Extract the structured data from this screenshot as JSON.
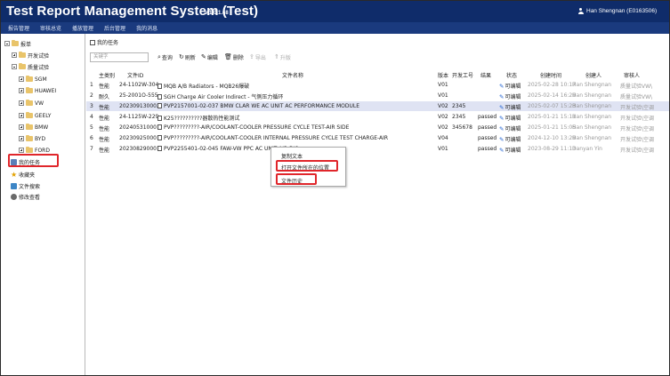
{
  "app": {
    "title": "Test Report Management System (Test)",
    "version": "v 1.0.1.68",
    "user": "Han Shengnan (E0163506)"
  },
  "menu": [
    "报告管理",
    "审核总览",
    "播放管理",
    "后台管理",
    "我的消息"
  ],
  "sidebar": {
    "items": [
      {
        "label": "报单",
        "level": 0,
        "expander": "minus",
        "icon": "folder-icon"
      },
      {
        "label": "开发试验",
        "level": 1,
        "expander": "plus",
        "icon": "folder-icon"
      },
      {
        "label": "质量试验",
        "level": 1,
        "expander": "minus",
        "icon": "folder-icon"
      },
      {
        "label": "SGM",
        "level": 2,
        "expander": "plus",
        "icon": "folder-icon"
      },
      {
        "label": "HUAWEI",
        "level": 2,
        "expander": "plus",
        "icon": "folder-icon"
      },
      {
        "label": "VW",
        "level": 2,
        "expander": "plus",
        "icon": "folder-icon"
      },
      {
        "label": "GEELY",
        "level": 2,
        "expander": "plus",
        "icon": "folder-icon"
      },
      {
        "label": "BMW",
        "level": 2,
        "expander": "plus",
        "icon": "folder-icon"
      },
      {
        "label": "BYD",
        "level": 2,
        "expander": "plus",
        "icon": "folder-icon"
      },
      {
        "label": "FORD",
        "level": 2,
        "expander": "plus",
        "icon": "folder-icon"
      },
      {
        "label": "我的任务",
        "level": 0,
        "expander": "none",
        "icon": "task-icon"
      },
      {
        "label": "收藏夹",
        "level": 0,
        "expander": "none",
        "icon": "star-icon"
      },
      {
        "label": "文件搜索",
        "level": 0,
        "expander": "none",
        "icon": "search-icon"
      },
      {
        "label": "修改查看",
        "level": 0,
        "expander": "none",
        "icon": "history-icon"
      }
    ]
  },
  "tab": {
    "label": "我的任务"
  },
  "toolbar": {
    "search_placeholder": "关键字",
    "buttons": [
      {
        "label": "查询",
        "icon": "search-icon",
        "disabled": false
      },
      {
        "label": "刷新",
        "icon": "refresh-icon",
        "disabled": false
      },
      {
        "label": "编辑",
        "icon": "edit-icon",
        "disabled": false
      },
      {
        "label": "删除",
        "icon": "delete-icon",
        "disabled": false
      },
      {
        "label": "导出",
        "icon": "export-icon",
        "disabled": true
      },
      {
        "label": "升版",
        "icon": "upgrade-icon",
        "disabled": true
      }
    ]
  },
  "table": {
    "columns": [
      "",
      "主类别",
      "文件ID",
      "文件名称",
      "版本",
      "开发工号",
      "结果",
      "状态",
      "创建时间",
      "创建人",
      "审核人"
    ],
    "rows": [
      {
        "no": "1",
        "cat": "性能",
        "id": "24-1102W-304",
        "name": "MQB A/B Radiators - MQB26爆破",
        "ver": "V01",
        "devno": "",
        "result": "",
        "status": "可编辑",
        "created": "2025-02-28 10:17",
        "creator": "Han Shengnan",
        "reviewer": "质量试验VW\\"
      },
      {
        "no": "2",
        "cat": "耐久",
        "id": "25-2001O-555",
        "name": "SGH Charge Air Cooler Indirect - 气侧压力循环",
        "ver": "V01",
        "devno": "",
        "result": "",
        "status": "可编辑",
        "created": "2025-02-14 16:29",
        "creator": "Han Shengnan",
        "reviewer": "质量试验VW\\"
      },
      {
        "no": "3",
        "cat": "性能",
        "id": "202309130002",
        "name": "PVP2157001-02-037 BMW CLAR WE AC UNIT AC PERFORMANCE MODULE",
        "ver": "V02",
        "devno": "2345",
        "result": "",
        "status": "可编辑",
        "created": "2025-02-07 15:23",
        "creator": "Han Shengnan",
        "reviewer": "开发试验\\空调"
      },
      {
        "no": "4",
        "cat": "性能",
        "id": "24-1125W-229",
        "name": "K25??????????器散热性能测试",
        "ver": "V02",
        "devno": "2345",
        "result": "passed",
        "status": "可编辑",
        "created": "2025-01-21 15:11",
        "creator": "Han Shengnan",
        "reviewer": "开发试验\\空调"
      },
      {
        "no": "5",
        "cat": "性能",
        "id": "202405310001",
        "name": "PVP?????????-AIR/COOLANT-COOLER PRESSURE CYCLE TEST-AIR SIDE",
        "ver": "V02",
        "devno": "345678",
        "result": "passed",
        "status": "可编辑",
        "created": "2025-01-21 15:05",
        "creator": "Han Shengnan",
        "reviewer": "开发试验\\空调"
      },
      {
        "no": "6",
        "cat": "性能",
        "id": "202309250001",
        "name": "PVP?????????-AIR/COOLANT-COOLER INTERNAL PRESSURE CYCLE TEST CHARGE-AIR",
        "ver": "V04",
        "devno": "",
        "result": "passed",
        "status": "可编辑",
        "created": "2024-12-10 13:29",
        "creator": "Han Shengnan",
        "reviewer": "开发试验\\空调"
      },
      {
        "no": "7",
        "cat": "性能",
        "id": "202308290001",
        "name": "PVP2255401-02-045 FAW-VW PPC AC UNIT AIR DIS",
        "ver": "V01",
        "devno": "",
        "result": "passed",
        "status": "可编辑",
        "created": "2023-08-29 11:13",
        "creator": "Danyan Yin",
        "reviewer": "开发试验\\空调"
      }
    ]
  },
  "context_menu": {
    "items": [
      "复制文本",
      "打开文件所在的位置",
      "文件历史"
    ]
  },
  "colors": {
    "titlebar": "#0f2c6a",
    "menubar": "#1a3a7e",
    "highlight": "#e0262b",
    "selected_row": "#dfe3f3"
  }
}
